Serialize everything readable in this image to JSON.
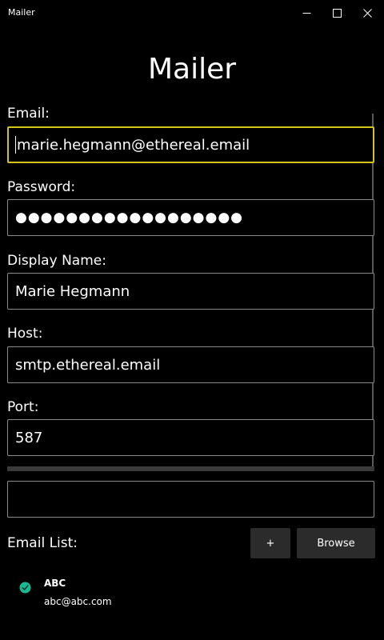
{
  "window": {
    "title": "Mailer"
  },
  "app": {
    "title": "Mailer"
  },
  "form": {
    "email": {
      "label": "Email:",
      "value": "marie.hegmann@ethereal.email"
    },
    "password": {
      "label": "Password:",
      "masked_value": "●●●●●●●●●●●●●●●●●●"
    },
    "display_name": {
      "label": "Display Name:",
      "value": "Marie Hegmann"
    },
    "host": {
      "label": "Host:",
      "value": "smtp.ethereal.email"
    },
    "port": {
      "label": "Port:",
      "value": "587"
    },
    "extra_input": {
      "value": ""
    }
  },
  "email_list": {
    "label": "Email List:",
    "add_label": "+",
    "browse_label": "Browse",
    "items": [
      {
        "name": "ABC",
        "email": "abc@abc.com",
        "icon": "check-circle-icon"
      }
    ]
  },
  "colors": {
    "background": "#000000",
    "focus_border": "#d4c41a",
    "input_border": "#8a8a8a",
    "button_bg": "#2b2b2b",
    "check_icon": "#1bb894"
  }
}
